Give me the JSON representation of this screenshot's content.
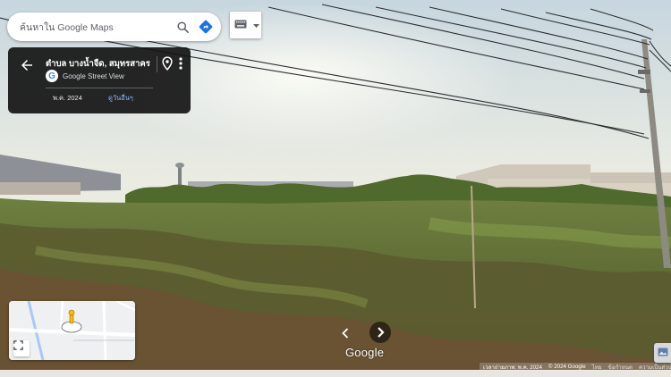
{
  "search": {
    "placeholder": "ค้นหาใน Google Maps",
    "search_icon": "search-icon",
    "directions_icon": "directions-icon"
  },
  "keyboard": {
    "icon": "keyboard-icon",
    "menu_icon": "chevron-down-icon"
  },
  "info_card": {
    "title": "ตำบล บางน้ำจืด, สมุทรสาคร",
    "subtitle": "Google Street View",
    "date": "พ.ค. 2024",
    "see_more": "ดูวันอื่นๆ",
    "back_icon": "arrow-back-icon",
    "pin_icon": "location-pin-icon",
    "more_icon": "more-vert-icon"
  },
  "minimap": {
    "expand_icon": "expand-icon",
    "marker_icon": "pegman-icon"
  },
  "navigation": {
    "prev_icon": "chevron-left-icon",
    "next_icon": "chevron-right-icon"
  },
  "logo": "Google",
  "footer": {
    "capture_date": "เวลาถ่ายภาพ: พ.ค. 2024",
    "copyright": "© 2024 Google",
    "item3": "ไทย",
    "item4": "ข้อกำหนด",
    "item5": "ความเป็นส่วน"
  },
  "colors": {
    "accent_blue": "#1a73e8",
    "card_bg": "#141414",
    "link_blue": "#8ab4f8"
  }
}
